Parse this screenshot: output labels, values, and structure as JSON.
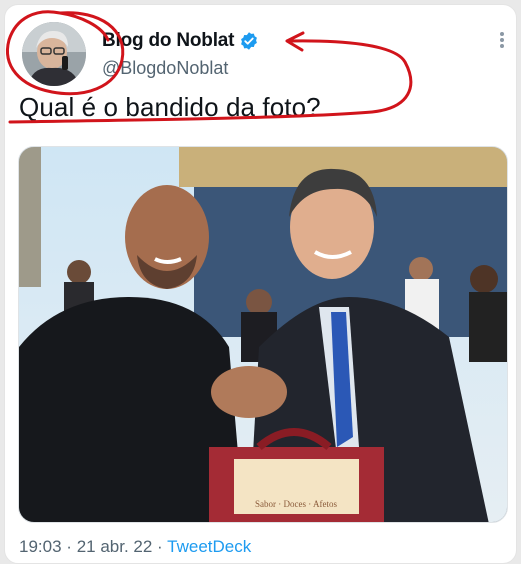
{
  "tweet": {
    "display_name": "Blog do Noblat",
    "handle": "@BlogdoNoblat",
    "text": "Qual é o bandido da foto?",
    "time": "19:03",
    "date": "21 abr. 22",
    "separator": "·",
    "source": "TweetDeck"
  },
  "media": {
    "box_label": "Sabor · Doces · Afetos"
  },
  "icons": {
    "verified": "verified-badge-icon",
    "more": "more-options-icon"
  },
  "colors": {
    "accent": "#1d9bf0",
    "secondary_text": "#536471",
    "annotation": "#d1141b"
  }
}
